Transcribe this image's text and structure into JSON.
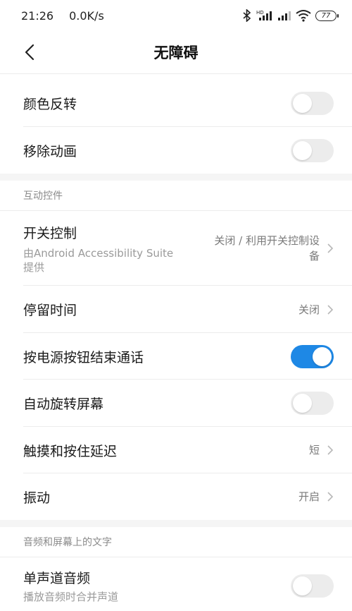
{
  "status": {
    "time": "21:26",
    "speed": "0.0K/s",
    "battery": "77"
  },
  "header": {
    "title": "无障碍"
  },
  "rows_top": [
    {
      "label": "颜色反转",
      "on": false
    },
    {
      "label": "移除动画",
      "on": false
    }
  ],
  "section_interaction": {
    "header": "互动控件",
    "switch_access": {
      "label": "开关控制",
      "sub1": "由Android Accessibility Suite",
      "sub2": "提供",
      "value1": "关闭 / 利用开关控制设",
      "value2": "备"
    },
    "dwell": {
      "label": "停留时间",
      "value": "关闭"
    },
    "power_end_call": {
      "label": "按电源按钮结束通话",
      "on": true
    },
    "auto_rotate": {
      "label": "自动旋转屏幕",
      "on": false
    },
    "touch_hold": {
      "label": "触摸和按住延迟",
      "value": "短"
    },
    "vibration": {
      "label": "振动",
      "value": "开启"
    }
  },
  "section_audio": {
    "header": "音频和屏幕上的文字",
    "mono": {
      "label": "单声道音频",
      "sub": "播放音频时合并声道",
      "on": false
    }
  },
  "colors": {
    "accent": "#1e88e5",
    "switch_off": "#ececec"
  }
}
